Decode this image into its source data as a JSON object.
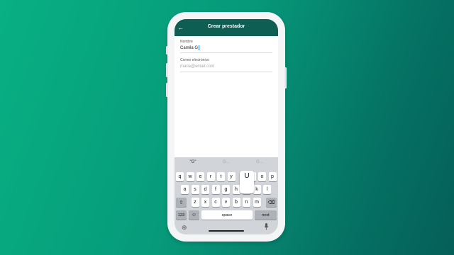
{
  "appbar": {
    "back_icon": "back-arrow-icon",
    "title": "Crear prestador"
  },
  "form": {
    "name_label": "Nombre",
    "name_value": "Camila G",
    "email_label": "Correo electrónico",
    "email_placeholder": "maria@email.com"
  },
  "keyboard": {
    "suggestions": [
      "\"G\"",
      "G...",
      "G..."
    ],
    "popup_letter": "U",
    "row1": [
      "q",
      "w",
      "e",
      "r",
      "t",
      "y",
      "u",
      "i",
      "o",
      "p"
    ],
    "row2": [
      "a",
      "s",
      "d",
      "f",
      "g",
      "h",
      "j",
      "k",
      "l"
    ],
    "row3": [
      "z",
      "x",
      "c",
      "v",
      "b",
      "n",
      "m"
    ],
    "shift_icon": "shift-icon",
    "delete_icon": "backspace-icon",
    "numbers_label": "123",
    "emoji_icon": "emoji-icon",
    "space_label": "space",
    "next_label": "next",
    "globe_icon": "globe-icon",
    "mic_icon": "microphone-icon"
  },
  "colors": {
    "background": "#08b083",
    "appbar": "#0e5e54",
    "keyboard": "#d1d4d9"
  }
}
